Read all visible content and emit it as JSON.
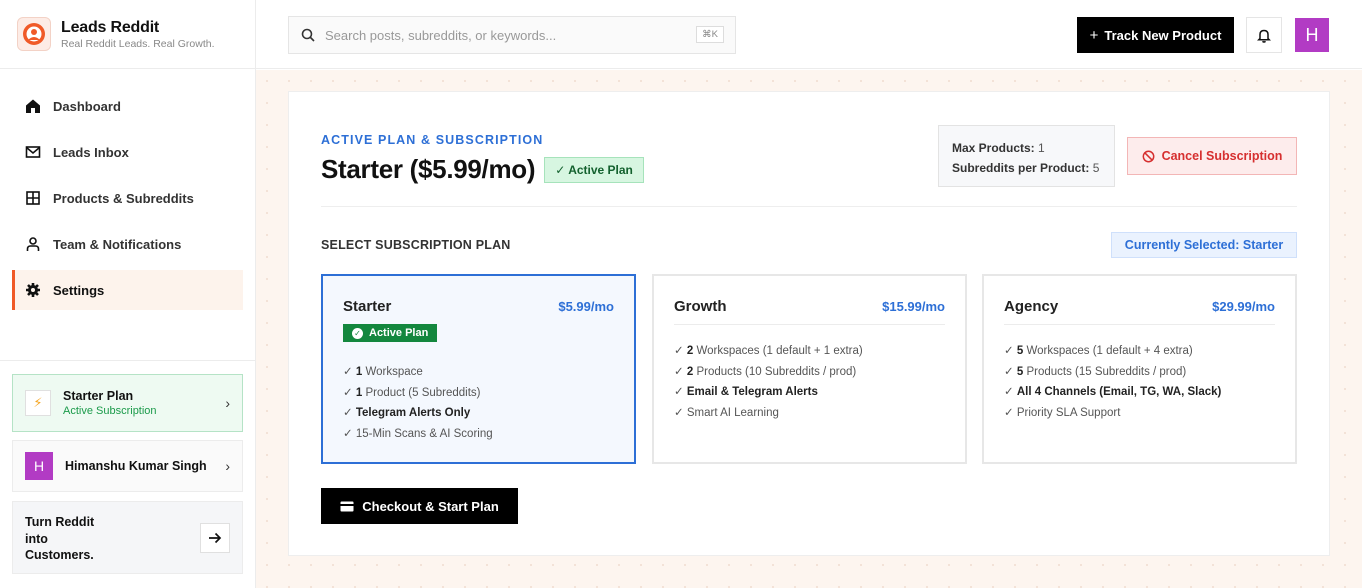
{
  "brand": {
    "name": "Leads Reddit",
    "tagline": "Real Reddit Leads. Real Growth."
  },
  "nav": [
    {
      "label": "Dashboard",
      "icon": "home-icon"
    },
    {
      "label": "Leads Inbox",
      "icon": "mail-icon"
    },
    {
      "label": "Products & Subreddits",
      "icon": "grid-icon"
    },
    {
      "label": "Team & Notifications",
      "icon": "user-icon"
    },
    {
      "label": "Settings",
      "icon": "gear-icon",
      "active": true
    }
  ],
  "sidebar_plan": {
    "title": "Starter Plan",
    "subtitle": "Active Subscription"
  },
  "sidebar_user": {
    "initial": "H",
    "name": "Himanshu Kumar Singh"
  },
  "promo": {
    "text": "Turn Reddit into Customers."
  },
  "search": {
    "placeholder": "Search posts, subreddits, or keywords...",
    "shortcut": "⌘K"
  },
  "topbar": {
    "track_label": "Track New Product",
    "avatar_initial": "H"
  },
  "subscription": {
    "eyebrow": "ACTIVE PLAN & SUBSCRIPTION",
    "title": "Starter ($5.99/mo)",
    "active_badge": "✓ Active Plan",
    "limits": {
      "max_products_label": "Max Products:",
      "max_products": "1",
      "subreddits_label": "Subreddits per Product:",
      "subreddits": "5"
    },
    "cancel_label": "Cancel Subscription"
  },
  "select": {
    "label": "SELECT SUBSCRIPTION PLAN",
    "current": "Currently Selected: Starter"
  },
  "plans": [
    {
      "name": "Starter",
      "price": "$5.99/mo",
      "badge": "Active Plan",
      "features": [
        {
          "bold": "1",
          "text": " Workspace"
        },
        {
          "bold": "1",
          "text": " Product (5 Subreddits)"
        },
        {
          "bold": "Telegram Alerts Only",
          "text": ""
        },
        {
          "bold": "",
          "text": "15-Min Scans & AI Scoring"
        }
      ]
    },
    {
      "name": "Growth",
      "price": "$15.99/mo",
      "features": [
        {
          "bold": "2",
          "text": " Workspaces (1 default + 1 extra)"
        },
        {
          "bold": "2",
          "text": " Products (10 Subreddits / prod)"
        },
        {
          "bold": "Email & Telegram Alerts",
          "text": ""
        },
        {
          "bold": "",
          "text": "Smart AI Learning"
        }
      ]
    },
    {
      "name": "Agency",
      "price": "$29.99/mo",
      "features": [
        {
          "bold": "5",
          "text": " Workspaces (1 default + 4 extra)"
        },
        {
          "bold": "5",
          "text": " Products (15 Subreddits / prod)"
        },
        {
          "bold": "All 4 Channels (Email, TG, WA, Slack)",
          "text": ""
        },
        {
          "bold": "",
          "text": "Priority SLA Support"
        }
      ]
    }
  ],
  "checkout_label": "Checkout & Start Plan",
  "colors": {
    "accent": "#f05a28",
    "link_blue": "#2d6fd6",
    "success": "#13873e",
    "danger": "#d62f2f"
  }
}
